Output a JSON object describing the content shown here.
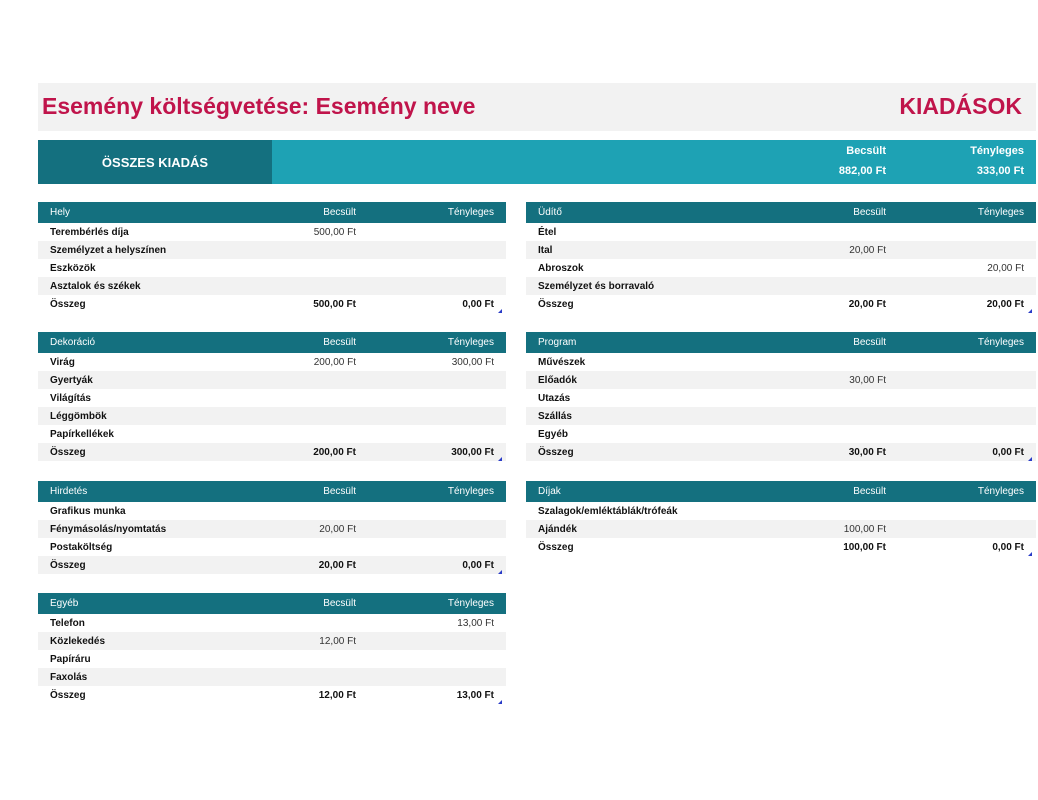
{
  "header": {
    "title": "Esemény költségvetése: Esemény neve",
    "right_title": "KIADÁSOK"
  },
  "total": {
    "label": "ÖSSZES KIADÁS",
    "est_label": "Becsült",
    "act_label": "Tényleges",
    "est_value": "882,00 Ft",
    "act_value": "333,00 Ft"
  },
  "sections": {
    "hely": {
      "title": "Hely",
      "est_label": "Becsült",
      "act_label": "Tényleges",
      "rows": [
        {
          "name": "Terembérlés díja",
          "est": "500,00 Ft",
          "act": ""
        },
        {
          "name": "Személyzet a helyszínen",
          "est": "",
          "act": ""
        },
        {
          "name": "Eszközök",
          "est": "",
          "act": ""
        },
        {
          "name": "Asztalok és székek",
          "est": "",
          "act": ""
        }
      ],
      "sum": {
        "name": "Összeg",
        "est": "500,00 Ft",
        "act": "0,00 Ft"
      }
    },
    "dekoracio": {
      "title": "Dekoráció",
      "est_label": "Becsült",
      "act_label": "Tényleges",
      "rows": [
        {
          "name": "Virág",
          "est": "200,00 Ft",
          "act": "300,00 Ft"
        },
        {
          "name": "Gyertyák",
          "est": "",
          "act": ""
        },
        {
          "name": "Világítás",
          "est": "",
          "act": ""
        },
        {
          "name": "Léggömbök",
          "est": "",
          "act": ""
        },
        {
          "name": "Papírkellékek",
          "est": "",
          "act": ""
        }
      ],
      "sum": {
        "name": "Összeg",
        "est": "200,00 Ft",
        "act": "300,00 Ft"
      }
    },
    "hirdetes": {
      "title": "Hirdetés",
      "est_label": "Becsült",
      "act_label": "Tényleges",
      "rows": [
        {
          "name": "Grafikus munka",
          "est": "",
          "act": ""
        },
        {
          "name": "Fénymásolás/nyomtatás",
          "est": "20,00 Ft",
          "act": ""
        },
        {
          "name": "Postaköltség",
          "est": "",
          "act": ""
        }
      ],
      "sum": {
        "name": "Összeg",
        "est": "20,00 Ft",
        "act": "0,00 Ft"
      }
    },
    "egyeb": {
      "title": "Egyéb",
      "est_label": "Becsült",
      "act_label": "Tényleges",
      "rows": [
        {
          "name": "Telefon",
          "est": "",
          "act": "13,00 Ft"
        },
        {
          "name": "Közlekedés",
          "est": "12,00 Ft",
          "act": ""
        },
        {
          "name": "Papíráru",
          "est": "",
          "act": ""
        },
        {
          "name": "Faxolás",
          "est": "",
          "act": ""
        }
      ],
      "sum": {
        "name": "Összeg",
        "est": "12,00 Ft",
        "act": "13,00 Ft"
      }
    },
    "udito": {
      "title": "Üdítő",
      "est_label": "Becsült",
      "act_label": "Tényleges",
      "rows": [
        {
          "name": "Étel",
          "est": "",
          "act": ""
        },
        {
          "name": "Ital",
          "est": "20,00 Ft",
          "act": ""
        },
        {
          "name": "Abroszok",
          "est": "",
          "act": "20,00 Ft"
        },
        {
          "name": "Személyzet és borravaló",
          "est": "",
          "act": ""
        }
      ],
      "sum": {
        "name": "Összeg",
        "est": "20,00 Ft",
        "act": "20,00 Ft"
      }
    },
    "program": {
      "title": "Program",
      "est_label": "Becsült",
      "act_label": "Tényleges",
      "rows": [
        {
          "name": "Művészek",
          "est": "",
          "act": ""
        },
        {
          "name": "Előadók",
          "est": "30,00 Ft",
          "act": ""
        },
        {
          "name": "Utazás",
          "est": "",
          "act": ""
        },
        {
          "name": "Szállás",
          "est": "",
          "act": ""
        },
        {
          "name": "Egyéb",
          "est": "",
          "act": ""
        }
      ],
      "sum": {
        "name": "Összeg",
        "est": "30,00 Ft",
        "act": "0,00 Ft"
      }
    },
    "dijak": {
      "title": "Díjak",
      "est_label": "Becsült",
      "act_label": "Tényleges",
      "rows": [
        {
          "name": "Szalagok/emléktáblák/trófeák",
          "est": "",
          "act": ""
        },
        {
          "name": "Ajándék",
          "est": "100,00 Ft",
          "act": ""
        }
      ],
      "sum": {
        "name": "Összeg",
        "est": "100,00 Ft",
        "act": "0,00 Ft"
      }
    }
  },
  "colors": {
    "accent": "#c0144b",
    "header_dark": "#14707f",
    "header_light": "#1ea2b4",
    "band": "#f2f2f2"
  }
}
